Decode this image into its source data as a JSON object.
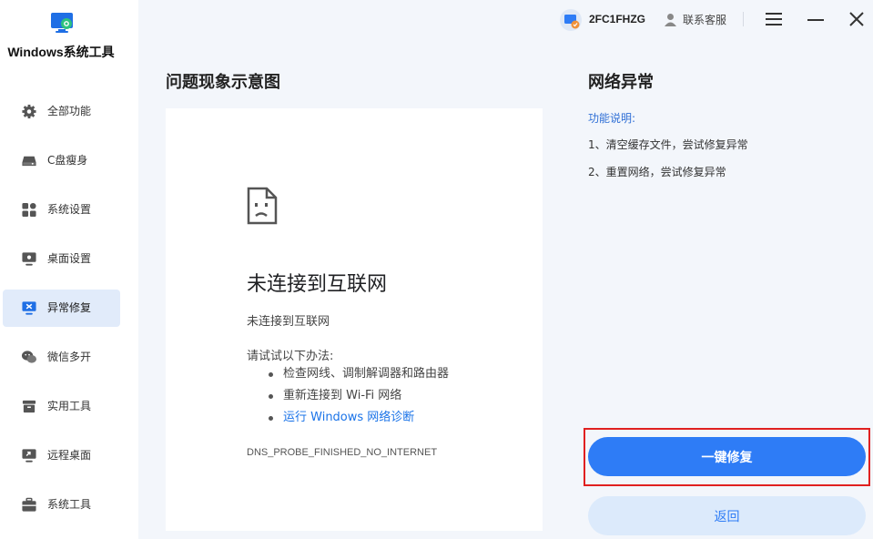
{
  "app": {
    "title": "Windows系统工具"
  },
  "sidebar": {
    "items": [
      {
        "label": "全部功能",
        "icon": "gear-icon",
        "active": false
      },
      {
        "label": "C盘瘦身",
        "icon": "disk-icon",
        "active": false
      },
      {
        "label": "系统设置",
        "icon": "grid-icon",
        "active": false
      },
      {
        "label": "桌面设置",
        "icon": "monitor-icon",
        "active": false
      },
      {
        "label": "异常修复",
        "icon": "repair-icon",
        "active": true
      },
      {
        "label": "微信多开",
        "icon": "wechat-icon",
        "active": false
      },
      {
        "label": "实用工具",
        "icon": "toolbox-icon",
        "active": false
      },
      {
        "label": "远程桌面",
        "icon": "remote-desktop-icon",
        "active": false
      },
      {
        "label": "系统工具",
        "icon": "briefcase-icon",
        "active": false
      }
    ]
  },
  "topbar": {
    "user_id": "2FC1FHZG",
    "support_label": "联系客服"
  },
  "left_panel": {
    "title": "问题现象示意图",
    "error": {
      "title": "未连接到互联网",
      "subtitle": "未连接到互联网",
      "try_label": "请试试以下办法:",
      "steps": [
        {
          "text": "检查网线、调制解调器和路由器",
          "link": false
        },
        {
          "text": "重新连接到 Wi-Fi 网络",
          "link": false
        },
        {
          "text": "运行 Windows 网络诊断",
          "link": true
        }
      ],
      "code": "DNS_PROBE_FINISHED_NO_INTERNET"
    }
  },
  "right_panel": {
    "title": "网络异常",
    "func_label": "功能说明:",
    "lines": [
      "1、清空缓存文件，尝试修复异常",
      "2、重置网络，尝试修复异常"
    ],
    "fix_button": "一键修复",
    "back_button": "返回"
  },
  "colors": {
    "accent": "#2e7cf6",
    "active_bg": "#e1ebfa",
    "highlight": "#e02020"
  }
}
